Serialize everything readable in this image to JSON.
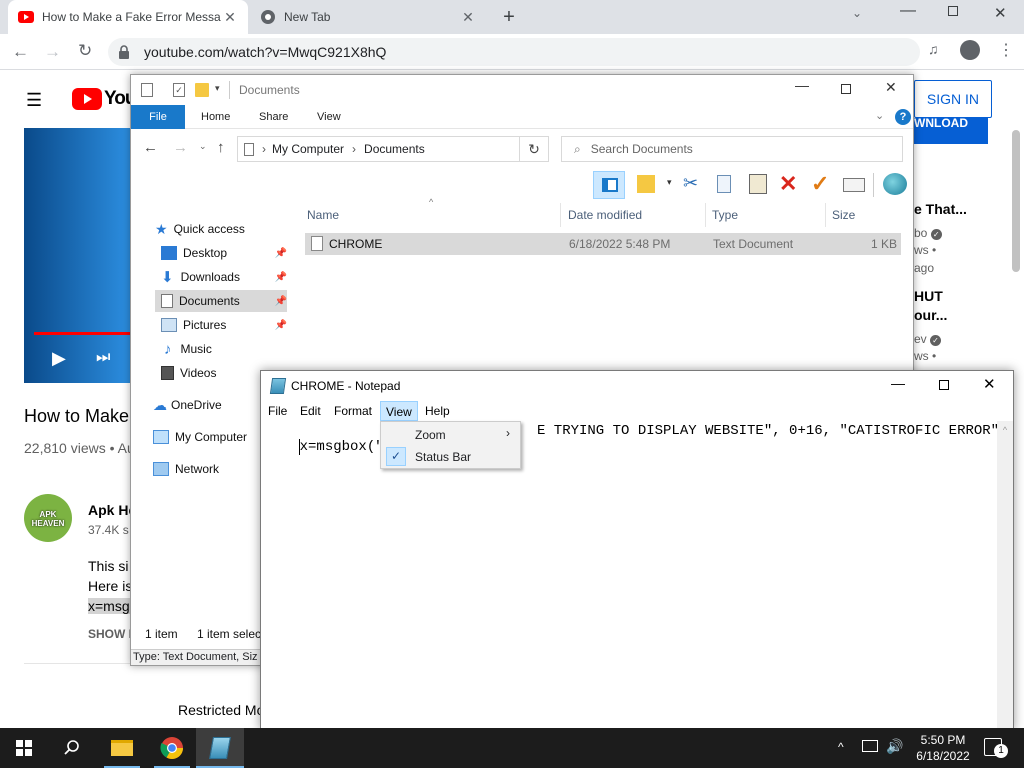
{
  "browser": {
    "tabs": [
      {
        "title": "How to Make a Fake Error Messa",
        "active": true
      },
      {
        "title": "New Tab",
        "active": false
      }
    ],
    "url": "youtube.com/watch?v=MwqC921X8hQ"
  },
  "youtube": {
    "logo_text": "You",
    "sign_in": "SIGN IN",
    "banner_fragment": "WNLOAD",
    "video_title_partial": "How to Make",
    "views": "22,810 views • Au",
    "channel_name": "Apk He",
    "subscribers": "37.4K s",
    "avatar_text": "APK HEAVEN",
    "desc_line1": "This si",
    "desc_line2": "Here is",
    "desc_line3": "x=msg",
    "show_more": "SHOW M",
    "restricted": "Restricted Mo",
    "rec1_title": "e That...",
    "rec1_channel": "bo",
    "rec1_views": "ws •",
    "rec1_age": "ago",
    "rec2_title1": "HUT",
    "rec2_title2": "our...",
    "rec2_channel": "ev",
    "rec2_views": "ws •"
  },
  "explorer": {
    "title": "Documents",
    "ribbon_tabs": [
      "File",
      "Home",
      "Share",
      "View"
    ],
    "breadcrumb": [
      "My Computer",
      "Documents"
    ],
    "search_placeholder": "Search Documents",
    "nav": {
      "quick_access": "Quick access",
      "desktop": "Desktop",
      "downloads": "Downloads",
      "documents": "Documents",
      "pictures": "Pictures",
      "music": "Music",
      "videos": "Videos",
      "onedrive": "OneDrive",
      "my_computer": "My Computer",
      "network": "Network"
    },
    "columns": {
      "name": "Name",
      "date": "Date modified",
      "type": "Type",
      "size": "Size"
    },
    "file": {
      "name": "CHROME",
      "date": "6/18/2022 5:48 PM",
      "type": "Text Document",
      "size": "1 KB"
    },
    "status_items": "1 item",
    "status_selected": "1 item selec",
    "details_bar": "Type: Text Document, Siz"
  },
  "notepad": {
    "title": "CHROME - Notepad",
    "menu": [
      "File",
      "Edit",
      "Format",
      "View",
      "Help"
    ],
    "text_left": "x=msgbox(\"CATIS",
    "text_right": "E TRYING TO DISPLAY WEBSITE\", 0+16, \"CATISTROFIC ERROR\")",
    "view_menu": {
      "zoom": "Zoom",
      "status_bar": "Status Bar",
      "status_bar_checked": true
    }
  },
  "taskbar": {
    "time": "5:50 PM",
    "date": "6/18/2022",
    "notification_count": "1"
  },
  "colors": {
    "youtube_red": "#ff0000",
    "youtube_blue": "#065fd4",
    "explorer_selection": "#cce8ff",
    "file_tab_blue": "#1979ca",
    "menu_highlight": "#cce8ff",
    "taskbar": "#1c1c1c"
  }
}
